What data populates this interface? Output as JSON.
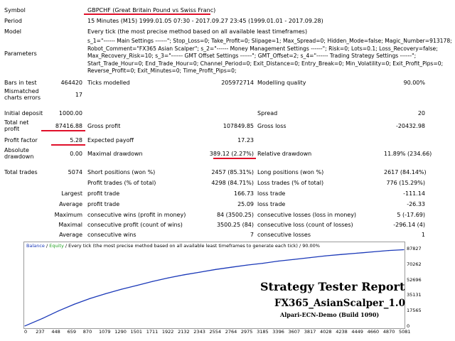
{
  "report": {
    "symbol_label": "Symbol",
    "symbol_value": "GBPCHF (Great Britain Pound vs Swiss Franc)",
    "period_label": "Period",
    "period_value": "15 Minutes (M15) 1999.01.05 07:30 - 2017.09.27 23:45 (1999.01.01 - 2017.09.28)",
    "model_label": "Model",
    "model_value": "Every tick (the most precise method based on all available least timeframes)",
    "parameters_label": "Parameters",
    "parameters_lines": [
      "s_1=\"------ Main Settings ------\"; Stop_Loss=0; Take_Profit=0; Slipage=1; Max_Spread=0; Hidden_Mode=false; Magic_Number=913178;",
      "Robot_Comment=\"FX365 Asian Scalper\"; s_2=\"------ Money Management Settings ------\"; Risk=0; Lots=0.1; Loss_Recovery=false;",
      "Max_Recovery_Risk=10; s_3=\"------ GMT Offset Settings ------\"; GMT_Offset=2; s_4=\"------ Trading Strategy Settings ------\";",
      "Start_Trade_Hour=0; End_Trade_Hour=0; Channel_Period=0; Exit_Distance=0; Entry_Break=0; Min_Volatility=0; Exit_Profit_Pips=0;",
      "Reverse_Profit=0; Exit_Minutes=0; Time_Profit_Pips=0;"
    ],
    "bars_label": "Bars in test",
    "bars_value": "464420",
    "ticks_label": "Ticks modelled",
    "ticks_value": "205972714",
    "quality_label": "Modelling quality",
    "quality_value": "90.00%",
    "mismatched_label_1": "Mismatched",
    "mismatched_label_2": "charts errors",
    "mismatched_value": "17",
    "deposit_label": "Initial deposit",
    "deposit_value": "1000.00",
    "spread_label": "Spread",
    "spread_value": "20",
    "net_label_1": "Total net",
    "net_label_2": "profit",
    "net_value": "87416.88",
    "gross_profit_label": "Gross profit",
    "gross_profit_value": "107849.85",
    "gross_loss_label": "Gross loss",
    "gross_loss_value": "-20432.98",
    "pf_label": "Profit factor",
    "pf_value": "5.28",
    "payoff_label": "Expected payoff",
    "payoff_value": "17.23",
    "abs_dd_label_1": "Absolute",
    "abs_dd_label_2": "drawdown",
    "abs_dd_value": "0.00",
    "max_dd_label": "Maximal drawdown",
    "max_dd_value": "389.12 (2.27%)",
    "rel_dd_label": "Relative drawdown",
    "rel_dd_value": "11.89% (234.66)",
    "trades_label": "Total trades",
    "trades_value": "5074",
    "short_label": "Short positions (won %)",
    "short_value": "2457 (85.31%)",
    "long_label": "Long positions (won %)",
    "long_value": "2617 (84.14%)",
    "profit_trades_label": "Profit trades (% of total)",
    "profit_trades_value": "4298 (84.71%)",
    "loss_trades_label": "Loss trades (% of total)",
    "loss_trades_value": "776 (15.29%)",
    "largest_label": "Largest",
    "largest_profit_label": "profit trade",
    "largest_profit_value": "166.73",
    "largest_loss_label": "loss trade",
    "largest_loss_value": "-111.14",
    "average_label": "Average",
    "average_profit_label": "profit trade",
    "average_profit_value": "25.09",
    "average_loss_label": "loss trade",
    "average_loss_value": "-26.33",
    "maximum_label": "Maximum",
    "max_cons_wins_label": "consecutive wins (profit in money)",
    "max_cons_wins_value": "84 (3500.25)",
    "max_cons_losses_label": "consecutive losses (loss in money)",
    "max_cons_losses_value": "5 (-17.69)",
    "maximal_label": "Maximal",
    "maximal_cons_profit_label": "consecutive profit (count of wins)",
    "maximal_cons_profit_value": "3500.25 (84)",
    "maximal_cons_loss_label": "consecutive loss (count of losses)",
    "maximal_cons_loss_value": "-296.14 (4)",
    "avg_cons_label": "Average",
    "avg_cons_wins_label": "consecutive wins",
    "avg_cons_wins_value": "7",
    "avg_cons_losses_label": "consecutive losses",
    "avg_cons_losses_value": "1"
  },
  "chart_header": {
    "balance": "Balance",
    "sep1": " / ",
    "equity": "Equity",
    "rest": " / Every tick (the most precise method based on all available least timeframes to generate each tick) / 90.00%"
  },
  "overlay": {
    "line1": "Strategy Tester Report",
    "line2": "FX365_AsianScalper_1.0",
    "line3": "Alpari-ECN-Demo (Build 1090)"
  },
  "colors": {
    "balance_line": "#1a38b8",
    "equity_line": "#22a022",
    "underline": "#e0102a"
  },
  "chart_data": {
    "type": "line",
    "title": "",
    "xlabel": "",
    "ylabel": "",
    "x_ticks": [
      "0",
      "237",
      "448",
      "659",
      "870",
      "1079",
      "1290",
      "1501",
      "1711",
      "1922",
      "2132",
      "2343",
      "2554",
      "2764",
      "2975",
      "3185",
      "3396",
      "3607",
      "3817",
      "4028",
      "4238",
      "4449",
      "4660",
      "4870",
      "5081"
    ],
    "y_ticks": [
      "87827",
      "70262",
      "52696",
      "35131",
      "17565",
      "0"
    ],
    "xlim": [
      0,
      5074
    ],
    "ylim": [
      0,
      87827
    ],
    "series": [
      {
        "name": "Balance",
        "x": [
          0,
          237,
          448,
          659,
          870,
          1079,
          1290,
          1501,
          1711,
          1922,
          2132,
          2343,
          2554,
          2764,
          2975,
          3185,
          3396,
          3607,
          3817,
          4028,
          4238,
          4449,
          4660,
          4870,
          5074
        ],
        "values": [
          1000,
          9500,
          18000,
          25500,
          32000,
          37500,
          42500,
          47000,
          51500,
          55500,
          59000,
          62000,
          65000,
          67500,
          70000,
          72000,
          74500,
          76500,
          78500,
          80500,
          82000,
          83500,
          85000,
          86500,
          87417
        ]
      }
    ]
  }
}
